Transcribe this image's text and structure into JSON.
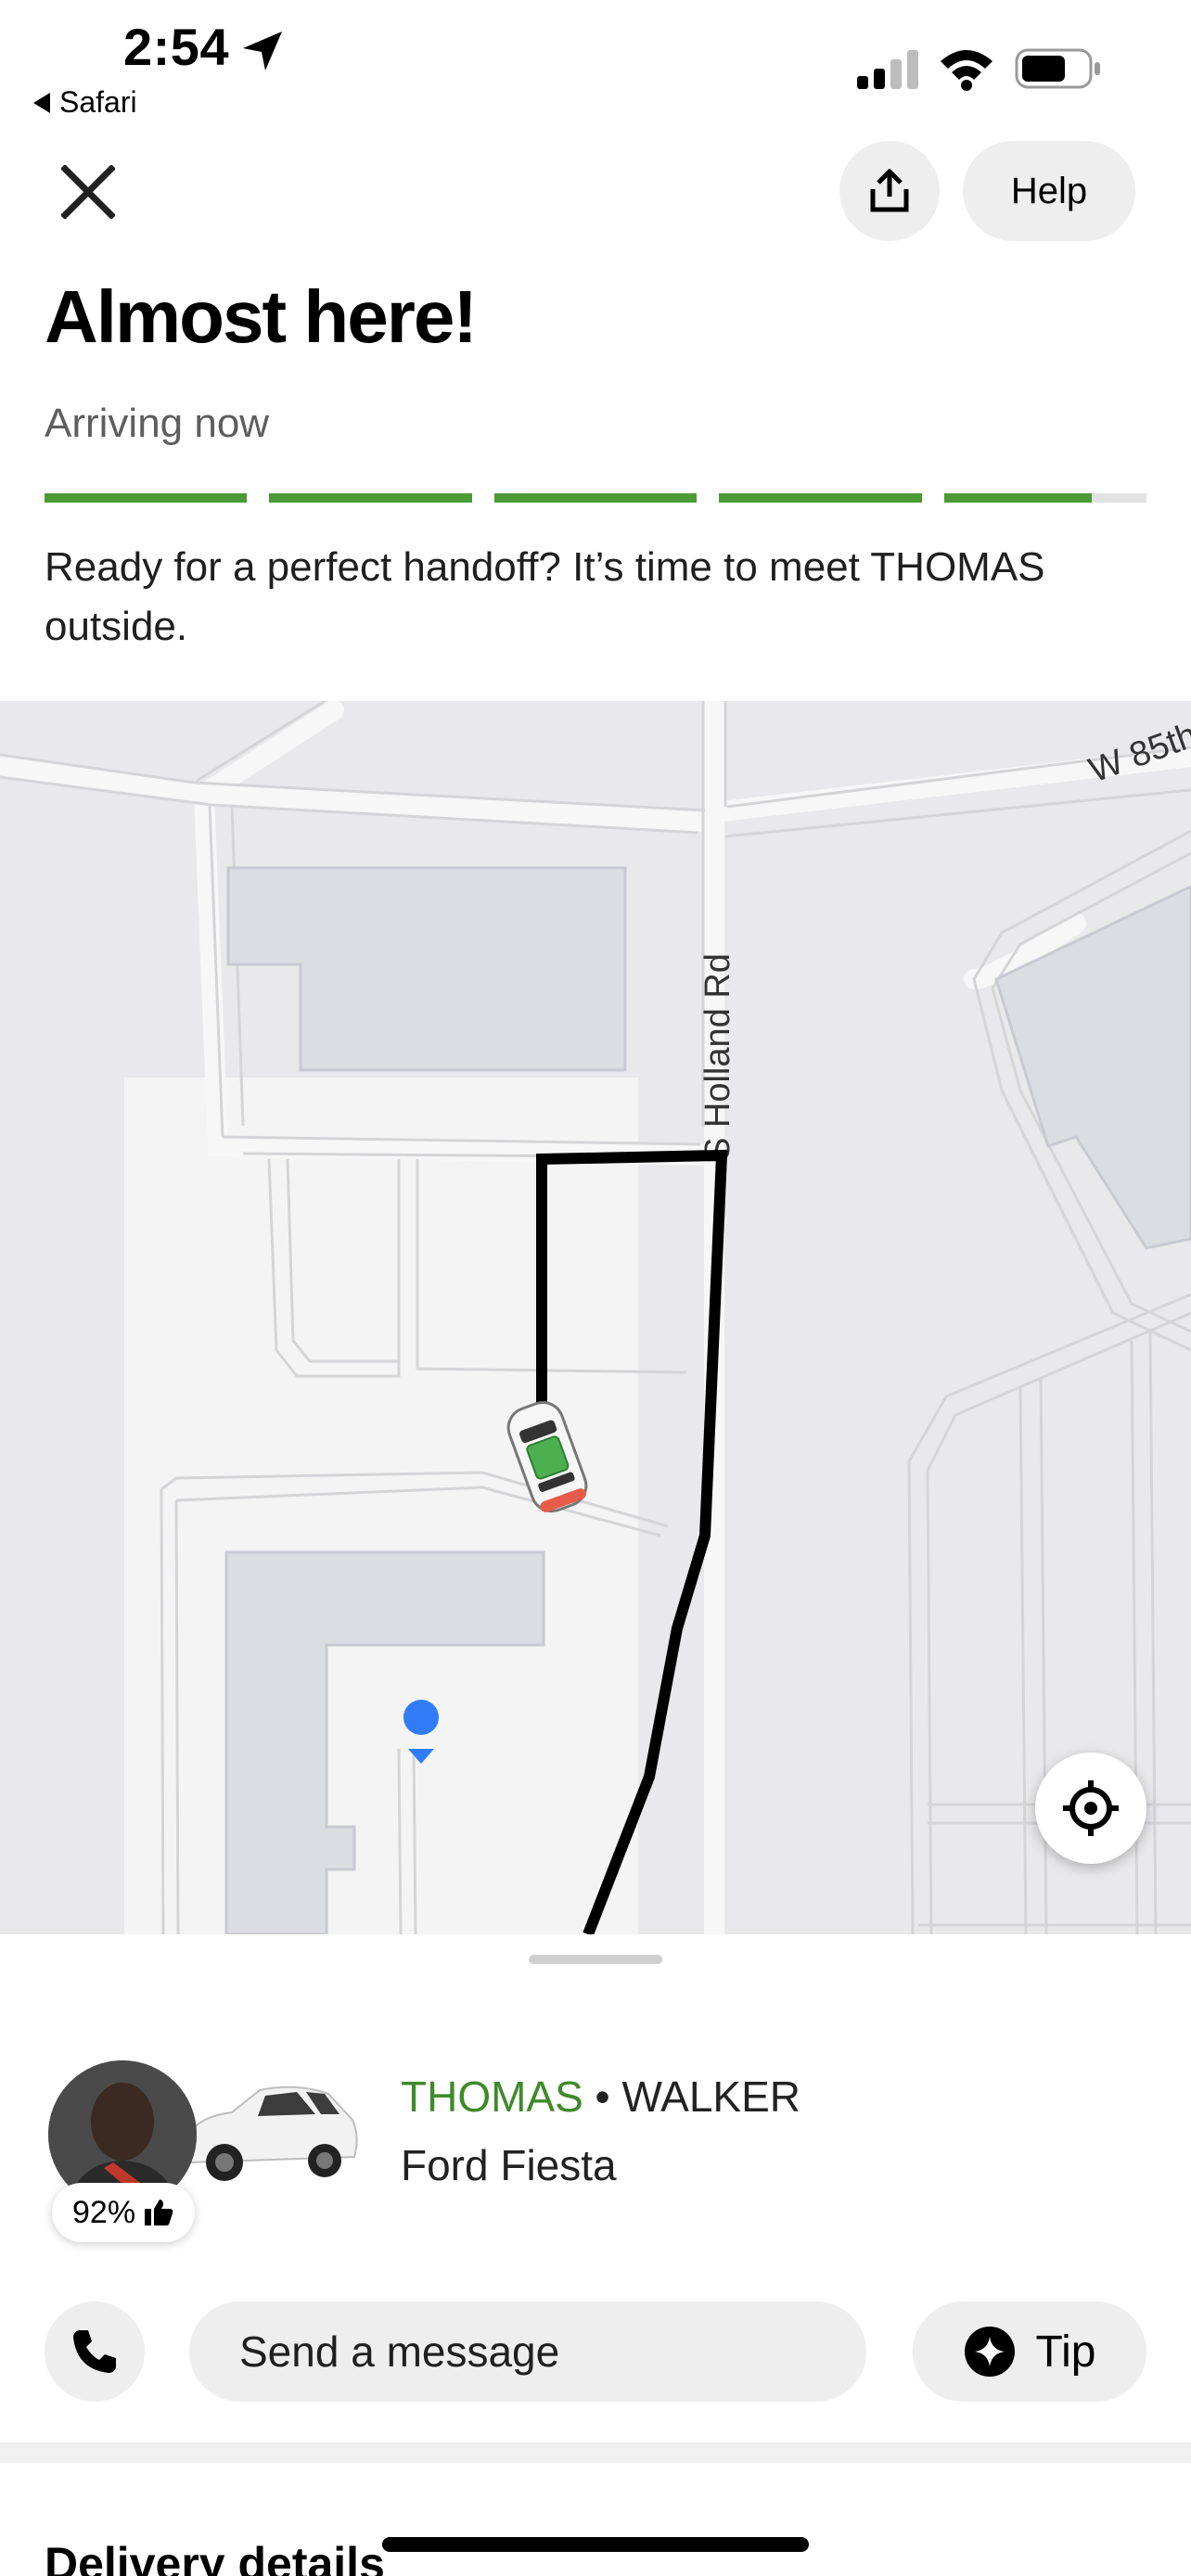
{
  "status_bar": {
    "time": "2:54",
    "back_app": "Safari"
  },
  "header": {
    "help_label": "Help"
  },
  "trip": {
    "headline": "Almost here!",
    "status": "Arriving now",
    "progress": [
      1,
      1,
      1,
      1,
      0.73
    ],
    "message": "Ready for a perfect handoff? It’s time to meet THOMAS outside."
  },
  "map": {
    "street_labels": [
      "W 85th",
      "S Holland Rd"
    ]
  },
  "driver": {
    "first_name": "THOMAS",
    "separator": " • ",
    "last_name": "WALKER",
    "vehicle": "Ford Fiesta",
    "rating": "92%"
  },
  "actions": {
    "message_placeholder": "Send a message",
    "tip_label": "Tip"
  },
  "details": {
    "section_title": "Delivery details"
  },
  "colors": {
    "accent_green": "#4b9a35",
    "driver_name_green": "#3f8a2b",
    "user_location_blue": "#2f7cf6"
  }
}
